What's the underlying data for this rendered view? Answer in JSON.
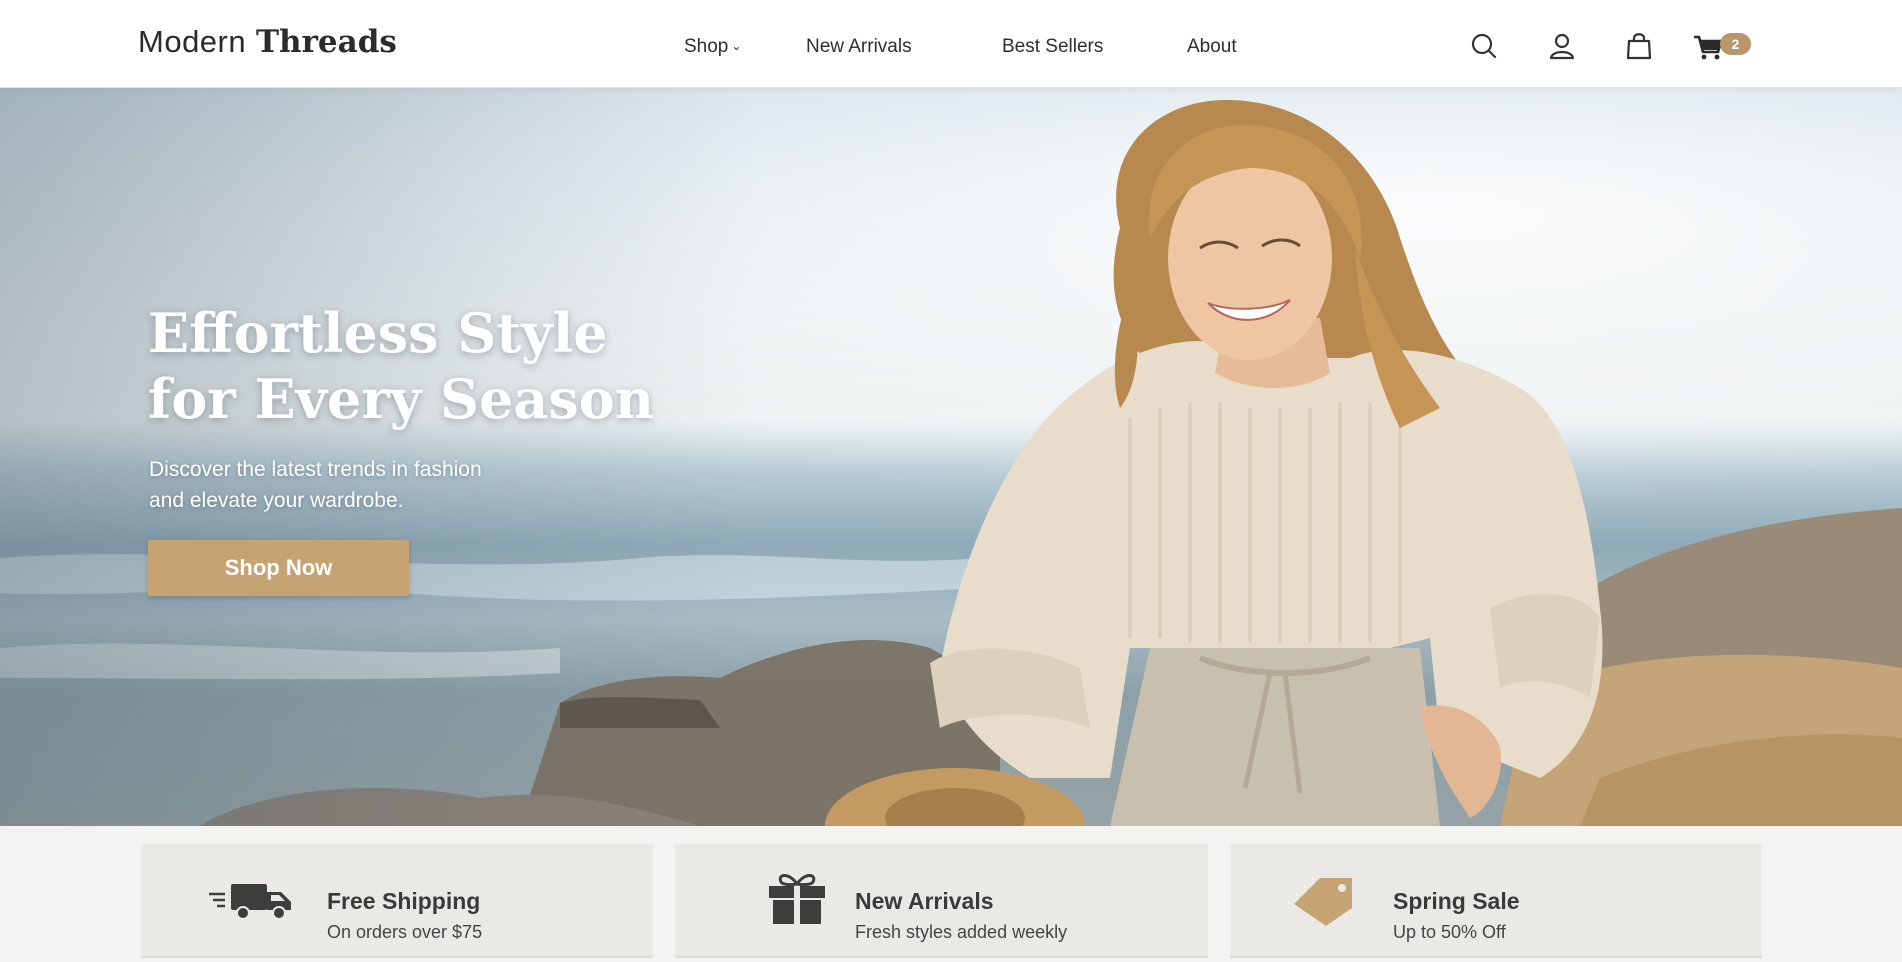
{
  "brand": {
    "name_light": "Modern",
    "name_bold": "Threads"
  },
  "nav": {
    "shop": "Shop",
    "new_arrivals": "New Arrivals",
    "best_sellers": "Best Sellers",
    "about": "About"
  },
  "header_icons": [
    "search-icon",
    "user-icon",
    "shopping-bag-icon",
    "cart-icon"
  ],
  "cart_count": "2",
  "hero": {
    "title_line1": "Effortless Style",
    "title_line2": "for Every Season",
    "subtitle_line1": "Discover the latest trends in fashion",
    "subtitle_line2": "and elevate your wardrobe.",
    "cta": "Shop Now"
  },
  "features": [
    {
      "icon": "truck-icon",
      "title": "Free Shipping",
      "subtitle": "On orders over $75"
    },
    {
      "icon": "gift-icon",
      "title": "New Arrivals",
      "subtitle": "Fresh styles added weekly"
    },
    {
      "icon": "tag-icon",
      "title": "Spring Sale",
      "subtitle": "Up to 50% Off"
    }
  ],
  "colors": {
    "accent": "#c6a372",
    "badge": "#b8956a",
    "header_bg": "#ffffff",
    "text": "#2e2e2e"
  }
}
